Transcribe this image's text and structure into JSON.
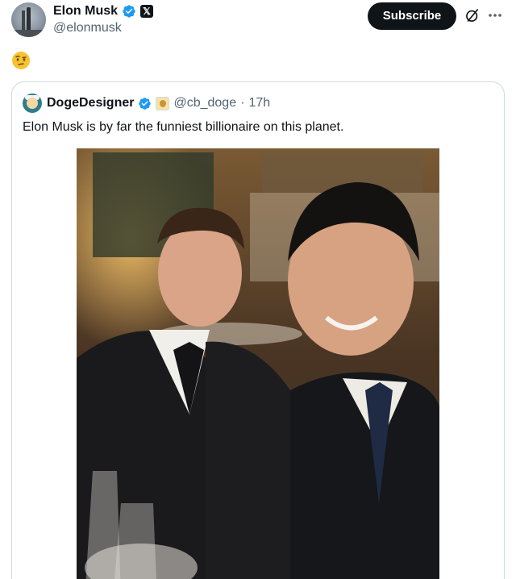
{
  "post": {
    "author_name": "Elon Musk",
    "author_handle": "@elonmusk",
    "verified_icon": "verified-badge-icon",
    "affiliate_icon": "x-logo-icon",
    "emoji": "🤨",
    "subscribe_label": "Subscribe",
    "grok_icon": "grok-icon",
    "more_icon": "more-options-icon"
  },
  "quote": {
    "author_name": "DogeDesigner",
    "author_handle": "@cb_doge",
    "separator": "·",
    "timestamp": "17h",
    "text": "Elon Musk is by far the funniest billionaire on this planet.",
    "media_description_icon": "photo"
  },
  "colors": {
    "accent_blue": "#1d9bf0",
    "text_primary": "#0f1419",
    "text_secondary": "#536471",
    "border": "#cfd9de"
  }
}
